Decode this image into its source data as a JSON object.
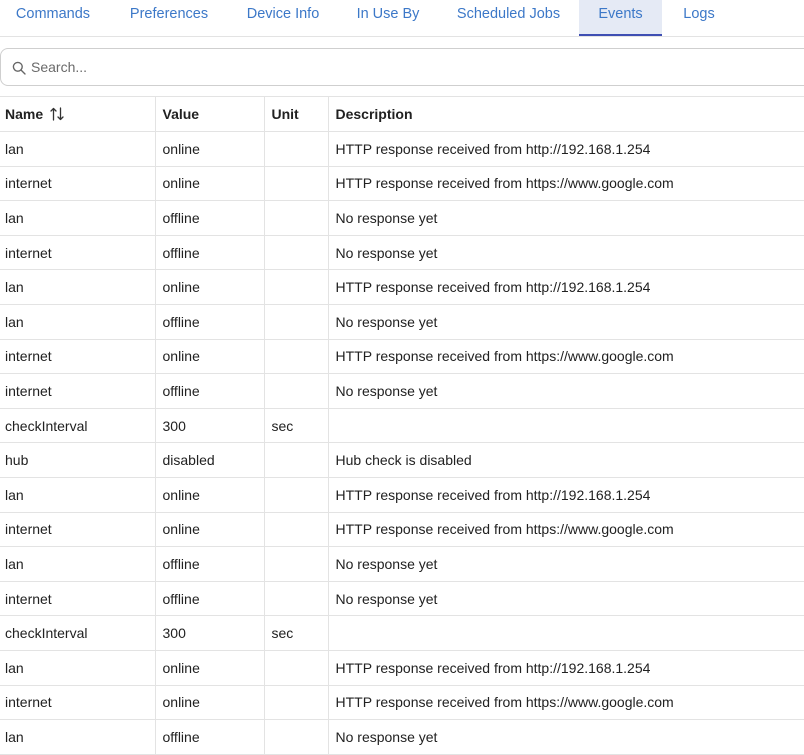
{
  "tabs": [
    {
      "label": "Commands",
      "active": false
    },
    {
      "label": "Preferences",
      "active": false
    },
    {
      "label": "Device Info",
      "active": false
    },
    {
      "label": "In Use By",
      "active": false
    },
    {
      "label": "Scheduled Jobs",
      "active": false
    },
    {
      "label": "Events",
      "active": true
    },
    {
      "label": "Logs",
      "active": false
    }
  ],
  "search": {
    "placeholder": "Search...",
    "value": "",
    "icon": "search-icon"
  },
  "table": {
    "columns": [
      "Name",
      "Value",
      "Unit",
      "Description"
    ],
    "sort_icon": "sort-arrows-icon",
    "rows": [
      {
        "name": "lan",
        "value": "online",
        "unit": "",
        "description": "HTTP response received from http://192.168.1.254"
      },
      {
        "name": "internet",
        "value": "online",
        "unit": "",
        "description": "HTTP response received from https://www.google.com"
      },
      {
        "name": "lan",
        "value": "offline",
        "unit": "",
        "description": "No response yet"
      },
      {
        "name": "internet",
        "value": "offline",
        "unit": "",
        "description": "No response yet"
      },
      {
        "name": "lan",
        "value": "online",
        "unit": "",
        "description": "HTTP response received from http://192.168.1.254"
      },
      {
        "name": "lan",
        "value": "offline",
        "unit": "",
        "description": "No response yet"
      },
      {
        "name": "internet",
        "value": "online",
        "unit": "",
        "description": "HTTP response received from https://www.google.com"
      },
      {
        "name": "internet",
        "value": "offline",
        "unit": "",
        "description": "No response yet"
      },
      {
        "name": "checkInterval",
        "value": "300",
        "unit": "sec",
        "description": ""
      },
      {
        "name": "hub",
        "value": "disabled",
        "unit": "",
        "description": "Hub check is disabled"
      },
      {
        "name": "lan",
        "value": "online",
        "unit": "",
        "description": "HTTP response received from http://192.168.1.254"
      },
      {
        "name": "internet",
        "value": "online",
        "unit": "",
        "description": "HTTP response received from https://www.google.com"
      },
      {
        "name": "lan",
        "value": "offline",
        "unit": "",
        "description": "No response yet"
      },
      {
        "name": "internet",
        "value": "offline",
        "unit": "",
        "description": "No response yet"
      },
      {
        "name": "checkInterval",
        "value": "300",
        "unit": "sec",
        "description": ""
      },
      {
        "name": "lan",
        "value": "online",
        "unit": "",
        "description": "HTTP response received from http://192.168.1.254"
      },
      {
        "name": "internet",
        "value": "online",
        "unit": "",
        "description": "HTTP response received from https://www.google.com"
      },
      {
        "name": "lan",
        "value": "offline",
        "unit": "",
        "description": "No response yet"
      }
    ]
  },
  "colors": {
    "accent": "#3c78c8",
    "active_tab_bg": "#e5eaf5",
    "active_tab_border": "#3f4fb3"
  }
}
